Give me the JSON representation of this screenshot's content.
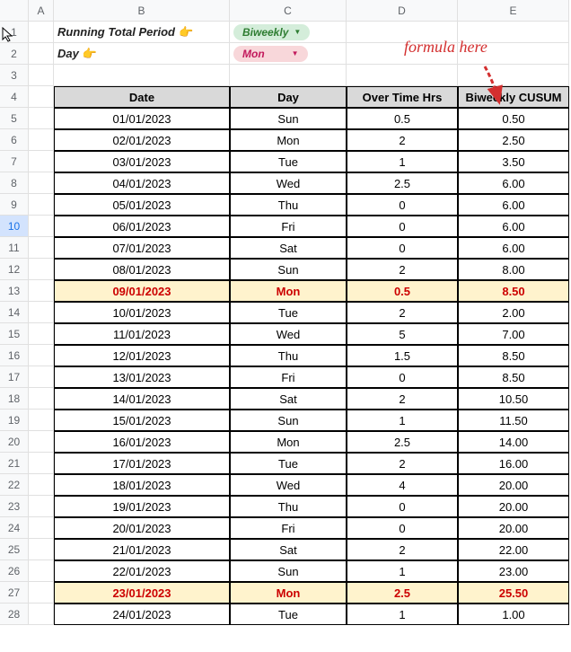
{
  "columns": [
    "A",
    "B",
    "C",
    "D",
    "E"
  ],
  "rowNumbers": [
    1,
    2,
    3,
    4,
    5,
    6,
    7,
    8,
    9,
    10,
    11,
    12,
    13,
    14,
    15,
    16,
    17,
    18,
    19,
    20,
    21,
    22,
    23,
    24,
    25,
    26,
    27,
    28
  ],
  "selectedRow": 10,
  "labels": {
    "runningPeriod": "Running Total Period",
    "day": "Day",
    "ptr": "👉"
  },
  "chips": {
    "period": "Biweekly",
    "day": "Mon",
    "triangle": "▼"
  },
  "annotation": "formula here",
  "headers": [
    "Date",
    "Day",
    "Over Time Hrs",
    "Biweekly CUSUM"
  ],
  "rows": [
    {
      "date": "01/01/2023",
      "day": "Sun",
      "ot": "0.5",
      "cusum": "0.50",
      "hl": false
    },
    {
      "date": "02/01/2023",
      "day": "Mon",
      "ot": "2",
      "cusum": "2.50",
      "hl": false
    },
    {
      "date": "03/01/2023",
      "day": "Tue",
      "ot": "1",
      "cusum": "3.50",
      "hl": false
    },
    {
      "date": "04/01/2023",
      "day": "Wed",
      "ot": "2.5",
      "cusum": "6.00",
      "hl": false
    },
    {
      "date": "05/01/2023",
      "day": "Thu",
      "ot": "0",
      "cusum": "6.00",
      "hl": false
    },
    {
      "date": "06/01/2023",
      "day": "Fri",
      "ot": "0",
      "cusum": "6.00",
      "hl": false
    },
    {
      "date": "07/01/2023",
      "day": "Sat",
      "ot": "0",
      "cusum": "6.00",
      "hl": false
    },
    {
      "date": "08/01/2023",
      "day": "Sun",
      "ot": "2",
      "cusum": "8.00",
      "hl": false
    },
    {
      "date": "09/01/2023",
      "day": "Mon",
      "ot": "0.5",
      "cusum": "8.50",
      "hl": true
    },
    {
      "date": "10/01/2023",
      "day": "Tue",
      "ot": "2",
      "cusum": "2.00",
      "hl": false
    },
    {
      "date": "11/01/2023",
      "day": "Wed",
      "ot": "5",
      "cusum": "7.00",
      "hl": false
    },
    {
      "date": "12/01/2023",
      "day": "Thu",
      "ot": "1.5",
      "cusum": "8.50",
      "hl": false
    },
    {
      "date": "13/01/2023",
      "day": "Fri",
      "ot": "0",
      "cusum": "8.50",
      "hl": false
    },
    {
      "date": "14/01/2023",
      "day": "Sat",
      "ot": "2",
      "cusum": "10.50",
      "hl": false
    },
    {
      "date": "15/01/2023",
      "day": "Sun",
      "ot": "1",
      "cusum": "11.50",
      "hl": false
    },
    {
      "date": "16/01/2023",
      "day": "Mon",
      "ot": "2.5",
      "cusum": "14.00",
      "hl": false
    },
    {
      "date": "17/01/2023",
      "day": "Tue",
      "ot": "2",
      "cusum": "16.00",
      "hl": false
    },
    {
      "date": "18/01/2023",
      "day": "Wed",
      "ot": "4",
      "cusum": "20.00",
      "hl": false
    },
    {
      "date": "19/01/2023",
      "day": "Thu",
      "ot": "0",
      "cusum": "20.00",
      "hl": false
    },
    {
      "date": "20/01/2023",
      "day": "Fri",
      "ot": "0",
      "cusum": "20.00",
      "hl": false
    },
    {
      "date": "21/01/2023",
      "day": "Sat",
      "ot": "2",
      "cusum": "22.00",
      "hl": false
    },
    {
      "date": "22/01/2023",
      "day": "Sun",
      "ot": "1",
      "cusum": "23.00",
      "hl": false
    },
    {
      "date": "23/01/2023",
      "day": "Mon",
      "ot": "2.5",
      "cusum": "25.50",
      "hl": true
    },
    {
      "date": "24/01/2023",
      "day": "Tue",
      "ot": "1",
      "cusum": "1.00",
      "hl": false
    }
  ]
}
